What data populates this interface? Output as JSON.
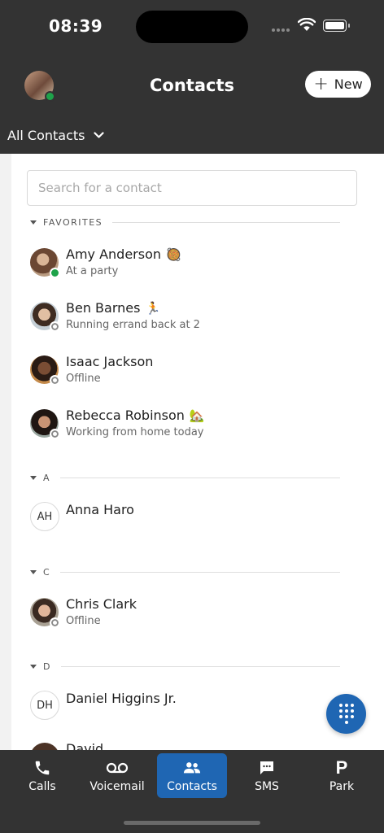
{
  "status_bar": {
    "time": "08:39"
  },
  "header": {
    "title": "Contacts",
    "new_label": "New",
    "filter_label": "All Contacts"
  },
  "search": {
    "placeholder": "Search for a contact"
  },
  "sections": {
    "favorites": "FAVORITES",
    "a": "A",
    "c": "C",
    "d": "D"
  },
  "contacts": [
    {
      "name": "Amy Anderson",
      "emoji": "🥘",
      "status": "At a party",
      "presence": "online"
    },
    {
      "name": "Ben Barnes",
      "emoji": "🏃",
      "status": "Running errand back at 2",
      "presence": "offline"
    },
    {
      "name": "Isaac Jackson",
      "emoji": "",
      "status": "Offline",
      "presence": "offline"
    },
    {
      "name": "Rebecca Robinson",
      "emoji": "🏡",
      "status": "Working from home today",
      "presence": "offline"
    },
    {
      "name": "Anna Haro",
      "initials": "AH",
      "status": ""
    },
    {
      "name": "Chris Clark",
      "emoji": "",
      "status": "Offline",
      "presence": "offline"
    },
    {
      "name": "Daniel Higgins Jr.",
      "initials": "DH",
      "status": ""
    },
    {
      "name": "David Davies"
    }
  ],
  "nav": {
    "calls": "Calls",
    "voicemail": "Voicemail",
    "contacts": "Contacts",
    "sms": "SMS",
    "park": "Park",
    "park_icon": "P"
  },
  "colors": {
    "header_bg": "#333333",
    "accent": "#1f66b3",
    "online": "#1ea34a"
  }
}
